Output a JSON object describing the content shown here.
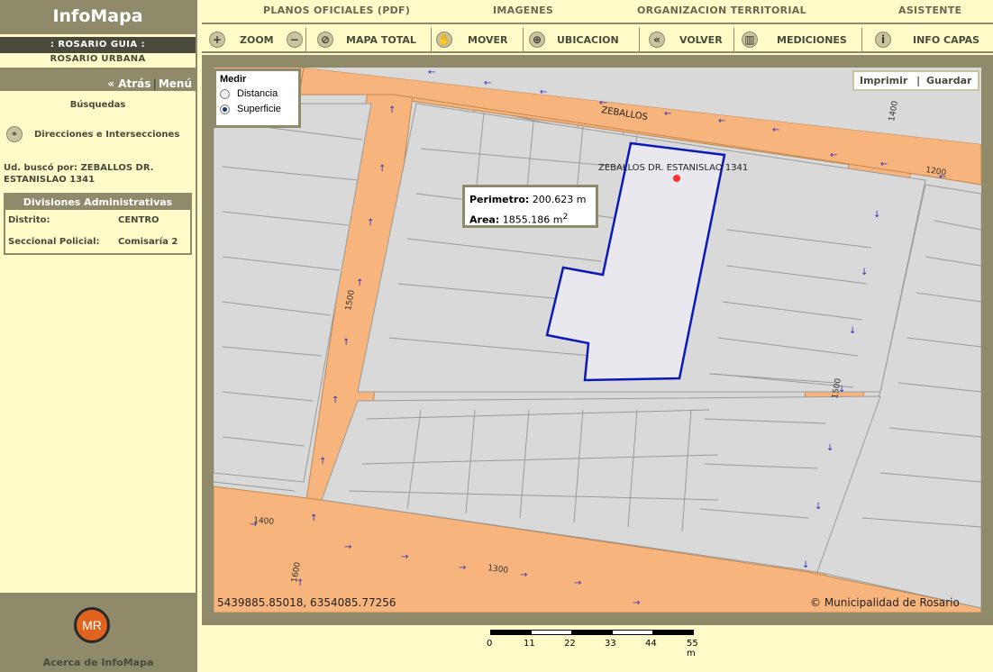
{
  "app": {
    "title": "InfoMapa",
    "guia": ":  ROSARIO GUIA  :",
    "urbana": "ROSARIO URBANA",
    "back_label": "« Atrás",
    "menu_label": "Menú"
  },
  "sidebar": {
    "searches_label": "Búsquedas",
    "directions_link": "Direcciones e Intersecciones",
    "search_result": "Ud. buscó por: ZEBALLOS DR. ESTANISLAO 1341",
    "divisions": {
      "header": "Divisiones Administrativas",
      "rows": [
        {
          "key": "Distrito:",
          "value": "CENTRO"
        },
        {
          "key": "Seccional Policial:",
          "value": "Comisaría 2"
        }
      ]
    },
    "logo_text": "MR",
    "about_label": "Acerca de InfoMapa"
  },
  "menu": {
    "items": [
      "PLANOS OFICIALES (PDF)",
      "IMAGENES",
      "ORGANIZACION TERRITORIAL",
      "ASISTENTE"
    ]
  },
  "toolbar": {
    "zoom_label": "ZOOM",
    "map_total_label": "MAPA TOTAL",
    "move_label": "MOVER",
    "location_label": "UBICACION",
    "back_label": "VOLVER",
    "measure_label": "MEDICIONES",
    "layers_label": "INFO CAPAS"
  },
  "measure_panel": {
    "title": "Medir",
    "options": [
      "Distancia",
      "Superficie"
    ],
    "selected": "Superficie"
  },
  "map_actions": {
    "print_label": "Imprimir",
    "save_label": "Guardar"
  },
  "measurement": {
    "perimeter_label": "Perimetro:",
    "perimeter_value": "200.623 m",
    "area_label": "Area:",
    "area_value": "1855.186 m",
    "area_exp": "2"
  },
  "map": {
    "street_label": "ZEBALLOS",
    "address_label": "ZEBALLOS DR. ESTANISLAO 1341",
    "number_labels": [
      "1400",
      "1200",
      "1500",
      "1500",
      "1400",
      "1600",
      "1300"
    ],
    "coords_text": "5439885.85018, 6354085.77256",
    "copyright": "© Municipalidad de Rosario"
  },
  "scale": {
    "labels": [
      "0",
      "11",
      "22",
      "33",
      "44",
      "55 m"
    ]
  }
}
